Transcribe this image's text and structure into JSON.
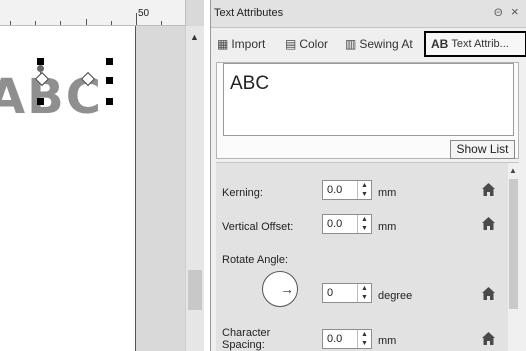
{
  "ruler": {
    "label": "50"
  },
  "canvas": {
    "text": "ABC"
  },
  "panel": {
    "title": "Text Attributes",
    "pin_glyph": "Θ",
    "close_glyph": "×"
  },
  "tabs": [
    {
      "label": "Import",
      "icon": "import-icon"
    },
    {
      "label": "Color",
      "icon": "color-icon"
    },
    {
      "label": "Sewing At",
      "icon": "sewing-icon"
    },
    {
      "label": "Text Attrib...",
      "icon_text": "AB"
    }
  ],
  "text_input": {
    "value": "ABC"
  },
  "show_list_label": "Show List",
  "fields": {
    "kerning": {
      "label": "Kerning:",
      "value": "0.0",
      "unit": "mm"
    },
    "vertical_offset": {
      "label": "Vertical Offset:",
      "value": "0.0",
      "unit": "mm"
    },
    "rotate_angle": {
      "label": "Rotate Angle:",
      "value": "0",
      "unit": "degree"
    },
    "character_spacing": {
      "label": "Character\nSpacing:",
      "value": "0.0",
      "unit": "mm"
    }
  },
  "colors": {
    "active_tab_border": "#000000",
    "canvas_text": "#8f8f8f"
  }
}
